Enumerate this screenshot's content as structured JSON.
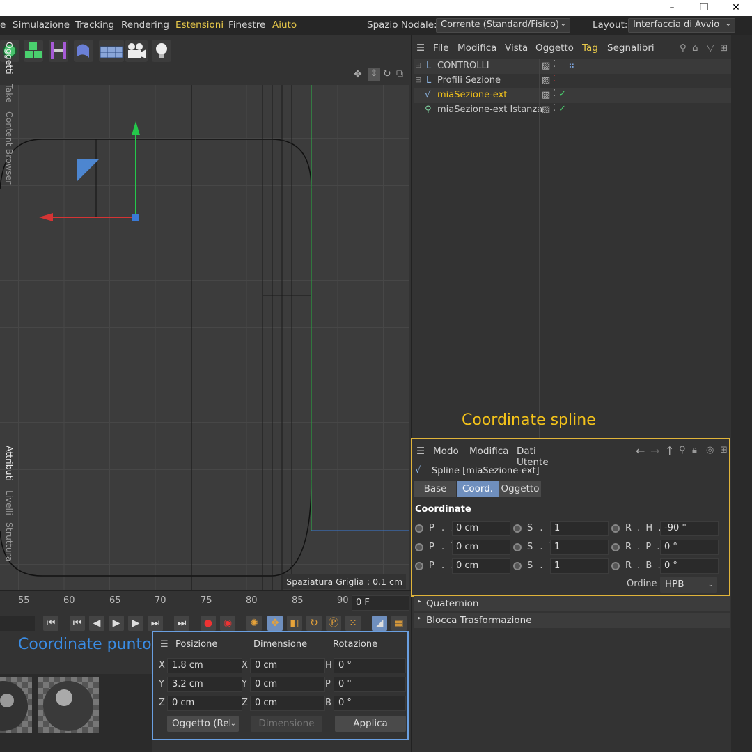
{
  "menu": [
    "e",
    "Simulazione",
    "Tracking",
    "Rendering",
    "Estensioni",
    "Finestre",
    "Aiuto"
  ],
  "spazio_label": "Spazio Nodale:",
  "spazio_value": "Corrente (Standard/Fisico)",
  "layout_label": "Layout:",
  "layout_value": "Interfaccia di Avvio",
  "obj_menu": [
    "File",
    "Modifica",
    "Vista",
    "Oggetto",
    "Tag",
    "Segnalibri"
  ],
  "objects": [
    "CONTROLLI",
    "Profili Sezione",
    "miaSezione-ext",
    "miaSezione-ext Istanza"
  ],
  "vtabs_top": [
    "Oggetti",
    "Take",
    "Content Browser"
  ],
  "vtabs_bottom": [
    "Attributi",
    "Livelli",
    "Struttura"
  ],
  "grid_label": "Spaziatura Griglia : 0.1 cm",
  "ruler": [
    "55",
    "60",
    "65",
    "70",
    "75",
    "80",
    "85",
    "90"
  ],
  "frame": "0 F",
  "annot_spline": "Coordinate spline",
  "annot_punto": "Coordinate punto",
  "attr_menu": [
    "Modo",
    "Modifica",
    "Dati Utente"
  ],
  "attr_title": "Spline [miaSezione-ext]",
  "attr_tabs": [
    "Base",
    "Coord.",
    "Oggetto"
  ],
  "section": "Coordinate",
  "coords": {
    "px_l": "P . X",
    "px": "0 cm",
    "py_l": "P . Y",
    "py": "0 cm",
    "pz_l": "P . Z",
    "pz": "0 cm",
    "sx_l": "S . X",
    "sx": "1",
    "sy_l": "S . Y",
    "sy": "1",
    "sz_l": "S . Z",
    "sz": "1",
    "rh_l": "R . H . .",
    "rh": "-90 °",
    "rp_l": "R . P . .",
    "rp": "0 °",
    "rb_l": "R . B . .",
    "rb": "0 °"
  },
  "ordine_label": "Ordine",
  "ordine": "HPB",
  "quaternion": "Quaternion",
  "blocca": "Blocca Trasformazione",
  "point": {
    "h_pos": "Posizione",
    "h_dim": "Dimensione",
    "h_rot": "Rotazione",
    "x": "1.8 cm",
    "y": "3.2 cm",
    "z": "0 cm",
    "dx": "0 cm",
    "dy": "0 cm",
    "dz": "0 cm",
    "h": "0 °",
    "p": "0 °",
    "b": "0 °",
    "mode": "Oggetto (Rel",
    "dim_btn": "Dimensione",
    "apply": "Applica"
  }
}
